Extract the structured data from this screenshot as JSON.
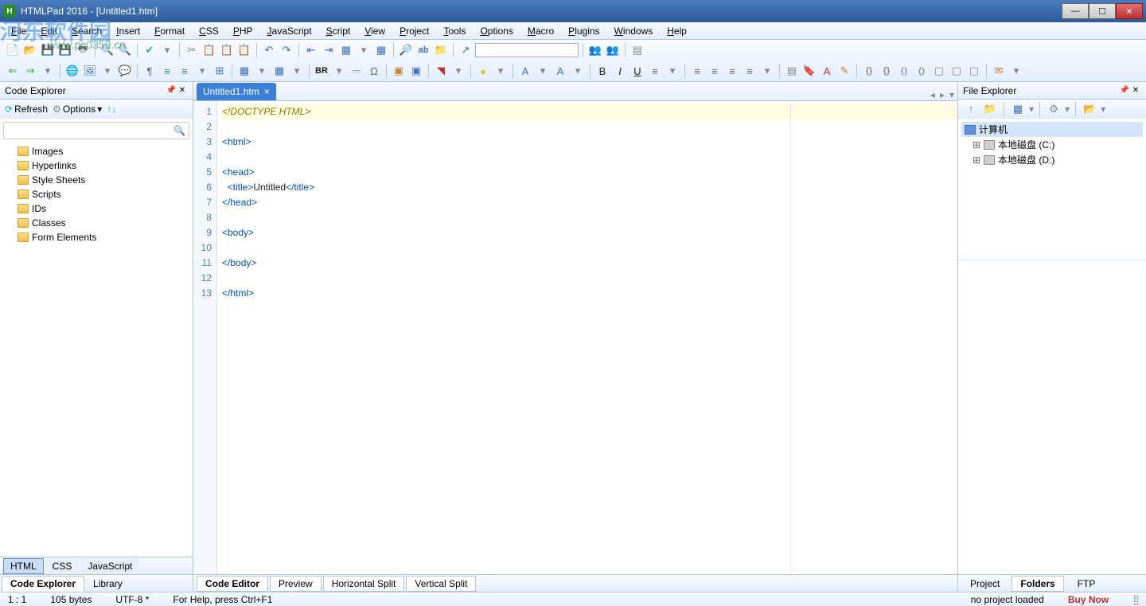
{
  "window": {
    "title": "HTMLPad 2016 - [Untitled1.htm]"
  },
  "menu": {
    "items": [
      "File",
      "Edit",
      "Search",
      "Insert",
      "Format",
      "CSS",
      "PHP",
      "JavaScript",
      "Script",
      "View",
      "Project",
      "Tools",
      "Options",
      "Macro",
      "Plugins",
      "Windows",
      "Help"
    ]
  },
  "watermark": {
    "main": "河东软件园",
    "sub": "www.pc0359.cn"
  },
  "left_panel": {
    "title": "Code Explorer",
    "refresh": "Refresh",
    "options": "Options",
    "tree": [
      "Images",
      "Hyperlinks",
      "Style Sheets",
      "Scripts",
      "IDs",
      "Classes",
      "Form Elements"
    ],
    "mode_tabs": [
      "HTML",
      "CSS",
      "JavaScript"
    ],
    "bottom_tabs": [
      "Code Explorer",
      "Library"
    ]
  },
  "editor": {
    "tab_name": "Untitled1.htm",
    "lines": [
      {
        "n": 1,
        "tokens": [
          {
            "cls": "tok-doctype",
            "t": "<!DOCTYPE HTML>"
          }
        ],
        "hl": true
      },
      {
        "n": 2,
        "tokens": []
      },
      {
        "n": 3,
        "tokens": [
          {
            "cls": "tok-tag",
            "t": "<html>"
          }
        ]
      },
      {
        "n": 4,
        "tokens": []
      },
      {
        "n": 5,
        "tokens": [
          {
            "cls": "tok-tag",
            "t": "<head>"
          }
        ]
      },
      {
        "n": 6,
        "tokens": [
          {
            "cls": "tok-text",
            "t": "  "
          },
          {
            "cls": "tok-tag",
            "t": "<title>"
          },
          {
            "cls": "tok-text",
            "t": "Untitled"
          },
          {
            "cls": "tok-tag",
            "t": "</title>"
          }
        ]
      },
      {
        "n": 7,
        "tokens": [
          {
            "cls": "tok-tag",
            "t": "</head>"
          }
        ]
      },
      {
        "n": 8,
        "tokens": []
      },
      {
        "n": 9,
        "tokens": [
          {
            "cls": "tok-tag",
            "t": "<body>"
          }
        ]
      },
      {
        "n": 10,
        "tokens": []
      },
      {
        "n": 11,
        "tokens": [
          {
            "cls": "tok-tag",
            "t": "</body>"
          }
        ]
      },
      {
        "n": 12,
        "tokens": []
      },
      {
        "n": 13,
        "tokens": [
          {
            "cls": "tok-tag",
            "t": "</html>"
          }
        ]
      }
    ],
    "view_tabs": [
      "Code Editor",
      "Preview",
      "Horizontal Split",
      "Vertical Split"
    ]
  },
  "right_panel": {
    "title": "File Explorer",
    "tree_root": "计算机",
    "drives": [
      "本地磁盘 (C:)",
      "本地磁盘 (D:)"
    ],
    "bottom_tabs": [
      "Project",
      "Folders",
      "FTP"
    ]
  },
  "status": {
    "pos": "1 : 1",
    "size": "105 bytes",
    "encoding": "UTF-8 *",
    "help": "For Help, press Ctrl+F1",
    "project": "no project loaded",
    "buy": "Buy Now"
  },
  "toolbar_icons_row1": [
    {
      "t": "📄",
      "c": "#c08030"
    },
    {
      "t": "📂",
      "c": "#c08030"
    },
    {
      "t": "💾",
      "c": "#4070c0"
    },
    {
      "t": "💾",
      "c": "#4070c0"
    },
    {
      "t": "🖶",
      "c": "#666"
    },
    "|",
    {
      "t": "🔍",
      "c": "#4a8"
    },
    {
      "t": "🔍",
      "c": "#4a8"
    },
    "|",
    {
      "t": "✔",
      "c": "#3a9"
    },
    {
      "t": "▾",
      "c": "#888"
    },
    "|",
    {
      "t": "✂",
      "c": "#888"
    },
    {
      "t": "📋",
      "c": "#c08030"
    },
    {
      "t": "📋",
      "c": "#c08030"
    },
    {
      "t": "📋",
      "c": "#c08030"
    },
    "|",
    {
      "t": "↶",
      "c": "#4070c0"
    },
    {
      "t": "↷",
      "c": "#4070c0"
    },
    "|",
    {
      "t": "⇤",
      "c": "#4070c0"
    },
    {
      "t": "⇥",
      "c": "#4070c0"
    },
    {
      "t": "▦",
      "c": "#4070c0"
    },
    {
      "t": "▾",
      "c": "#888"
    },
    {
      "t": "▦",
      "c": "#4070c0"
    },
    "|",
    {
      "t": "🔎",
      "c": "#4070c0"
    },
    {
      "t": "ab",
      "c": "#4070c0"
    },
    {
      "t": "📁",
      "c": "#c08030"
    },
    "|",
    {
      "t": "↗",
      "c": "#4070c0"
    },
    "input",
    "|",
    {
      "t": "👥",
      "c": "#a78"
    },
    {
      "t": "👥",
      "c": "#a78"
    },
    "|",
    {
      "t": "▤",
      "c": "#888"
    }
  ],
  "toolbar_icons_row2": [
    {
      "t": "⇐",
      "c": "#3a9a3a"
    },
    {
      "t": "⇒",
      "c": "#3a9a3a"
    },
    {
      "t": "▾",
      "c": "#888"
    },
    "|",
    {
      "t": "🌐",
      "c": "#4070c0"
    },
    {
      "t": "🖼",
      "c": "#4070c0"
    },
    {
      "t": "▾",
      "c": "#888"
    },
    {
      "t": "💬",
      "c": "#6a8"
    },
    "|",
    {
      "t": "¶",
      "c": "#666"
    },
    {
      "t": "≡",
      "c": "#4070c0"
    },
    {
      "t": "≡",
      "c": "#4070c0"
    },
    {
      "t": "▾",
      "c": "#888"
    },
    {
      "t": "⊞",
      "c": "#4070c0"
    },
    "|",
    {
      "t": "▦",
      "c": "#4070c0"
    },
    {
      "t": "▾",
      "c": "#888"
    },
    {
      "t": "▦",
      "c": "#4070c0"
    },
    {
      "t": "▾",
      "c": "#888"
    },
    "|",
    {
      "t": "BR",
      "c": "#222"
    },
    {
      "t": "▾",
      "c": "#888"
    },
    {
      "t": "⎓",
      "c": "#4070c0"
    },
    {
      "t": "Ω",
      "c": "#666"
    },
    "|",
    {
      "t": "▣",
      "c": "#c08030"
    },
    {
      "t": "▣",
      "c": "#4070c0"
    },
    "|",
    {
      "t": "◥",
      "c": "#c03030"
    },
    {
      "t": "▾",
      "c": "#888"
    },
    "|",
    {
      "t": "●",
      "c": "#e0c040"
    },
    {
      "t": "▾",
      "c": "#888"
    },
    "|",
    {
      "t": "A",
      "c": "#4070c0"
    },
    {
      "t": "▾",
      "c": "#888"
    },
    {
      "t": "A",
      "c": "#4070c0"
    },
    {
      "t": "▾",
      "c": "#888"
    },
    "|",
    {
      "t": "B",
      "c": "#222"
    },
    {
      "t": "I",
      "c": "#222",
      "i": true
    },
    {
      "t": "U",
      "c": "#222",
      "u": true
    },
    {
      "t": "≡",
      "c": "#666"
    },
    {
      "t": "▾",
      "c": "#888"
    },
    "|",
    {
      "t": "≡",
      "c": "#666"
    },
    {
      "t": "≡",
      "c": "#666"
    },
    {
      "t": "≡",
      "c": "#666"
    },
    {
      "t": "≡",
      "c": "#666"
    },
    {
      "t": "▾",
      "c": "#888"
    },
    "|",
    {
      "t": "▤",
      "c": "#888"
    },
    {
      "t": "🔖",
      "c": "#c08030"
    },
    {
      "t": "A",
      "c": "#c03030"
    },
    {
      "t": "✎",
      "c": "#c08030"
    },
    "|",
    {
      "t": "{}",
      "c": "#888"
    },
    {
      "t": "{}",
      "c": "#888"
    },
    {
      "t": "⟨⟩",
      "c": "#888"
    },
    {
      "t": "⟨⟩",
      "c": "#888"
    },
    {
      "t": "▢",
      "c": "#888"
    },
    {
      "t": "▢",
      "c": "#888"
    },
    {
      "t": "▢",
      "c": "#888"
    },
    "|",
    {
      "t": "✉",
      "c": "#c08030"
    },
    {
      "t": "▾",
      "c": "#888"
    }
  ]
}
